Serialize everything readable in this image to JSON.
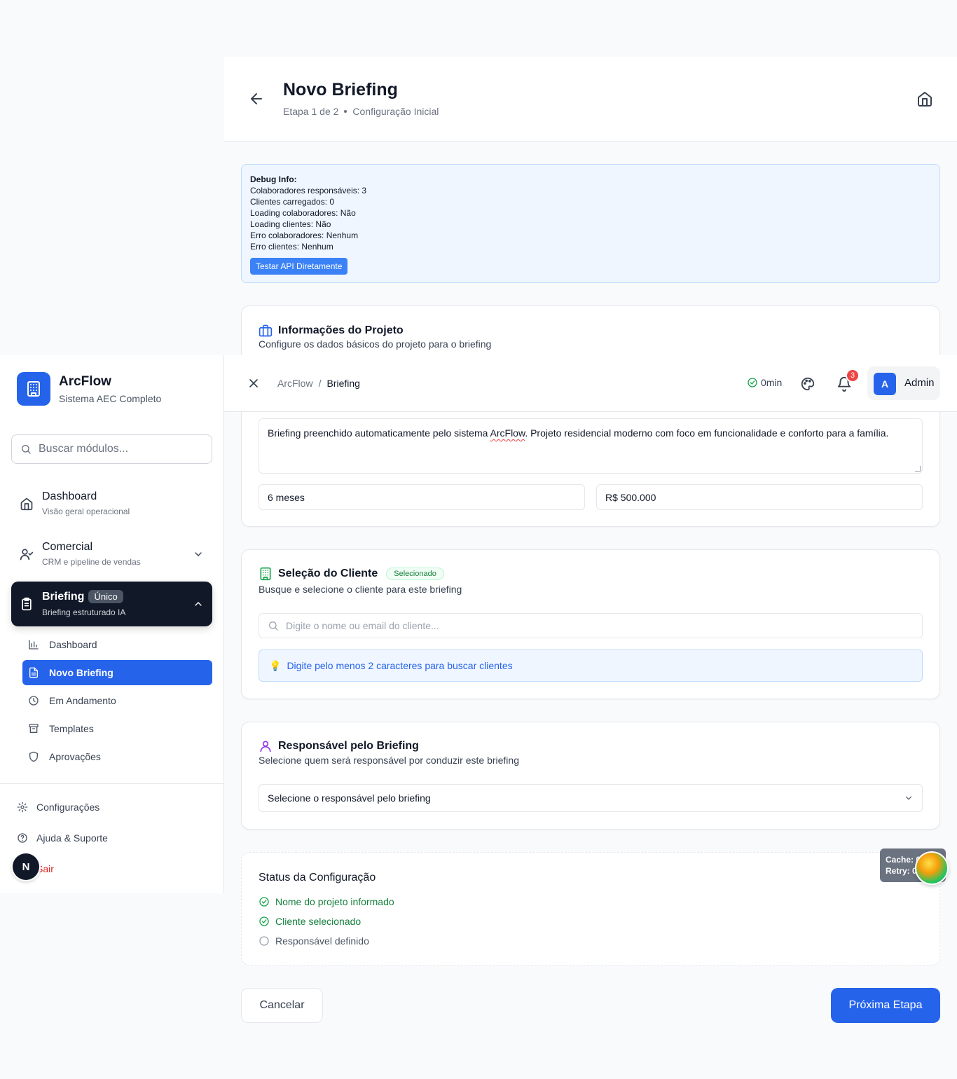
{
  "header": {
    "title": "Novo Briefing",
    "step": "Etapa 1 de 2",
    "step_name": "Configuração Inicial"
  },
  "debug": {
    "title": "Debug Info:",
    "lines": [
      "Colaboradores responsáveis: 3",
      "Clientes carregados: 0",
      "Loading colaboradores: Não",
      "Loading clientes: Não",
      "Erro colaboradores: Nenhum",
      "Erro clientes: Nenhum"
    ],
    "button": "Testar API Diretamente"
  },
  "project": {
    "title": "Informações do Projeto",
    "desc": "Configure os dados básicos do projeto para o briefing",
    "description_text_1": "Briefing preenchido automaticamente pelo sistema ",
    "description_spell": "ArcFlow",
    "description_text_2": ". Projeto residencial moderno com foco em funcionalidade e conforto para a família.",
    "duration": "6 meses",
    "budget": "R$ 500.000"
  },
  "client": {
    "title": "Seleção do Cliente",
    "badge": "Selecionado",
    "desc": "Busque e selecione o cliente para este briefing",
    "search_placeholder": "Digite o nome ou email do cliente...",
    "hint": "Digite pelo menos 2 caracteres para buscar clientes"
  },
  "responsible": {
    "title": "Responsável pelo Briefing",
    "desc": "Selecione quem será responsável por conduzir este briefing",
    "select_value": "Selecione o responsável pelo briefing"
  },
  "status": {
    "title": "Status da Configuração",
    "items": [
      {
        "label": "Nome do projeto informado",
        "done": true
      },
      {
        "label": "Cliente selecionado",
        "done": true
      },
      {
        "label": "Responsável definido",
        "done": false
      }
    ]
  },
  "actions": {
    "cancel": "Cancelar",
    "next": "Próxima Etapa"
  },
  "sidebar": {
    "brand": "ArcFlow",
    "brand_sub": "Sistema AEC Completo",
    "search_placeholder": "Buscar módulos...",
    "nav": [
      {
        "label": "Dashboard",
        "sub": "Visão geral operacional"
      },
      {
        "label": "Comercial",
        "sub": "CRM e pipeline de vendas"
      },
      {
        "label": "Briefing",
        "sub": "Briefing estruturado IA",
        "badge": "Único"
      }
    ],
    "subnav": [
      "Dashboard",
      "Novo Briefing",
      "Em Andamento",
      "Templates",
      "Aprovações"
    ],
    "footer": [
      "Configurações",
      "Ajuda & Suporte",
      "Sair"
    ]
  },
  "topbar": {
    "crumb_root": "ArcFlow",
    "crumb_sep": "/",
    "crumb_current": "Briefing",
    "timer": "0min",
    "notifications": "3",
    "avatar_letter": "A",
    "user": "Admin"
  },
  "widgets": {
    "cache_line": "Cache: 0",
    "retry_line": "Retry: 0",
    "n_badge": "N"
  },
  "colors": {
    "primary": "#2563eb",
    "dark": "#111827",
    "success": "#15803d",
    "danger": "#ef4444"
  }
}
